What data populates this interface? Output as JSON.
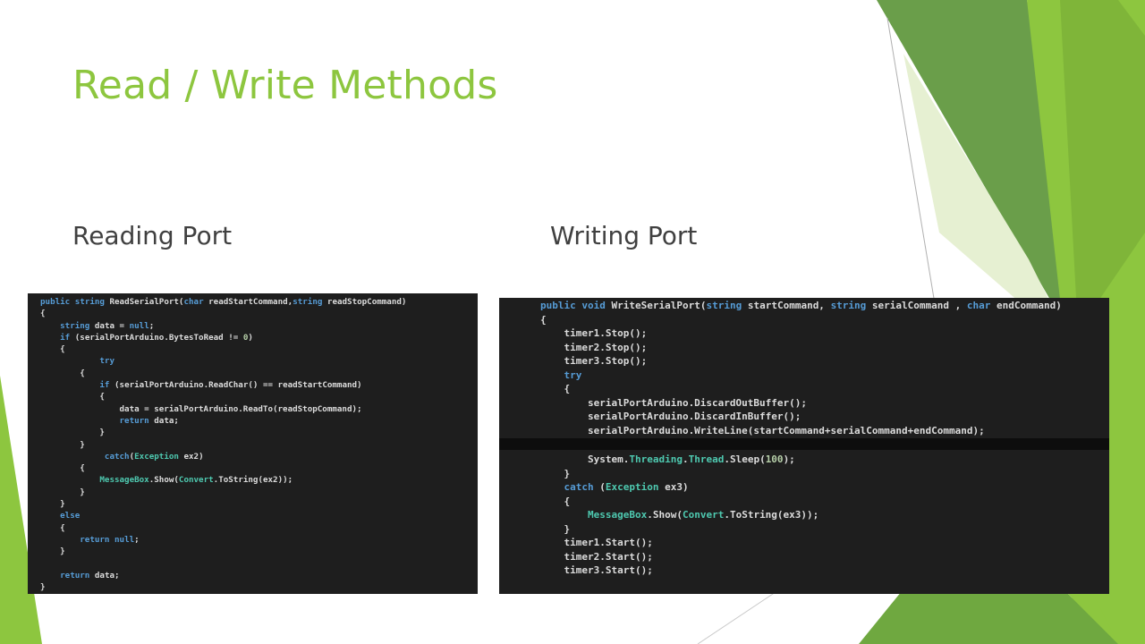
{
  "slide": {
    "title": "Read / Write Methods",
    "left_heading": "Reading Port",
    "right_heading": "Writing Port"
  },
  "code_read": {
    "lines": [
      "public string ReadSerialPort(char readStartCommand,string readStopCommand)",
      "{",
      "    string data = null;",
      "    if (serialPortArduino.BytesToRead != 0)",
      "    {",
      "            try",
      "        {",
      "            if (serialPortArduino.ReadChar() == readStartCommand)",
      "            {",
      "                data = serialPortArduino.ReadTo(readStopCommand);",
      "                return data;",
      "            }",
      "        }",
      "             catch(Exception ex2)",
      "        {",
      "            MessageBox.Show(Convert.ToString(ex2));",
      "        }",
      "    }",
      "    else",
      "    {",
      "        return null;",
      "    }",
      "",
      "    return data;",
      "}"
    ]
  },
  "code_write": {
    "lines_top": [
      "public void WriteSerialPort(string startCommand, string serialCommand , char endCommand)",
      "{",
      "    timer1.Stop();",
      "    timer2.Stop();",
      "    timer3.Stop();",
      "    try",
      "    {",
      "        serialPortArduino.DiscardOutBuffer();",
      "        serialPortArduino.DiscardInBuffer();",
      "        serialPortArduino.WriteLine(startCommand+serialCommand+endCommand);"
    ],
    "lines_bottom": [
      "        System.Threading.Thread.Sleep(100);",
      "    }",
      "    catch (Exception ex3)",
      "    {",
      "        MessageBox.Show(Convert.ToString(ex3));",
      "    }",
      "    timer1.Start();",
      "    timer2.Start();",
      "    timer3.Start();",
      "",
      "}"
    ]
  },
  "colors": {
    "title": "#8dc63f",
    "heading": "#404040",
    "code_bg": "#1e1e1e",
    "keyword": "#569cd6",
    "type": "#4ec9b0",
    "number": "#b5cea8",
    "accent_green": "#8dc63f",
    "dark_green": "#5a9e3a"
  }
}
